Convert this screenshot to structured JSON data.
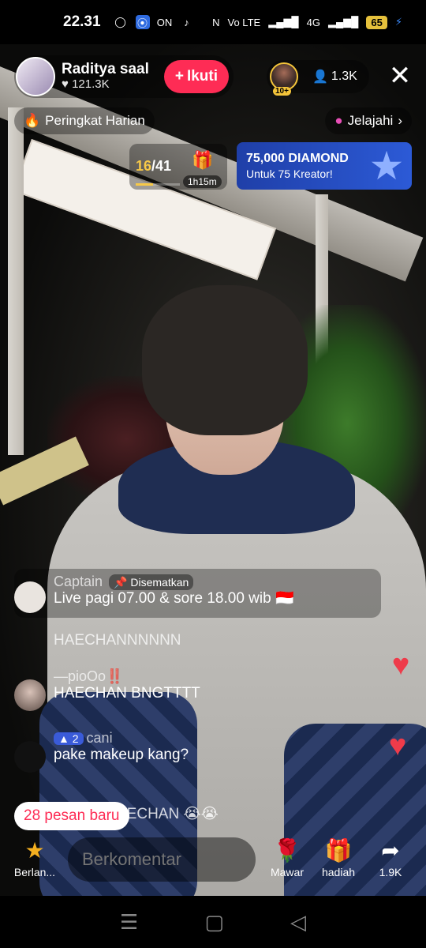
{
  "status_bar": {
    "time": "22.31",
    "network": "4G",
    "volte": "Vo LTE",
    "battery": "65"
  },
  "host": {
    "name": "Raditya saal",
    "likes": "121.3K",
    "follow_label": "Ikuti"
  },
  "viewers": {
    "top_rank_badge": "10+",
    "count": "1.3K"
  },
  "chips": {
    "daily_rank": "Peringkat Harian",
    "explore": "Jelajahi"
  },
  "goal": {
    "current": "16",
    "total": "/41",
    "timer": "1h15m",
    "progress": 0.39
  },
  "diamond_banner": {
    "title": "75,000 DIAMOND",
    "subtitle": "Untuk 75 Kreator!"
  },
  "chat": {
    "pinned": {
      "user": "Captain",
      "tag": "Disematkan",
      "text": "Live pagi 07.00 & sore 18.00 wib 🇮🇩"
    },
    "messages": [
      {
        "user": "",
        "text": "HAECHANNNNNN"
      },
      {
        "user": "—pioOo‼️",
        "text": "HAECHAN BNGTTTT"
      },
      {
        "user": "cani",
        "badge": "2",
        "text": "pake makeup kang?"
      },
      {
        "user": "",
        "text": "AECHAN 😭😭"
      }
    ]
  },
  "new_messages": "28 pesan baru",
  "bottom": {
    "star_label": "Berlan...",
    "comment_placeholder": "Berkomentar",
    "rose_label": "Mawar",
    "gift_label": "hadiah",
    "share_count": "1.9K"
  }
}
